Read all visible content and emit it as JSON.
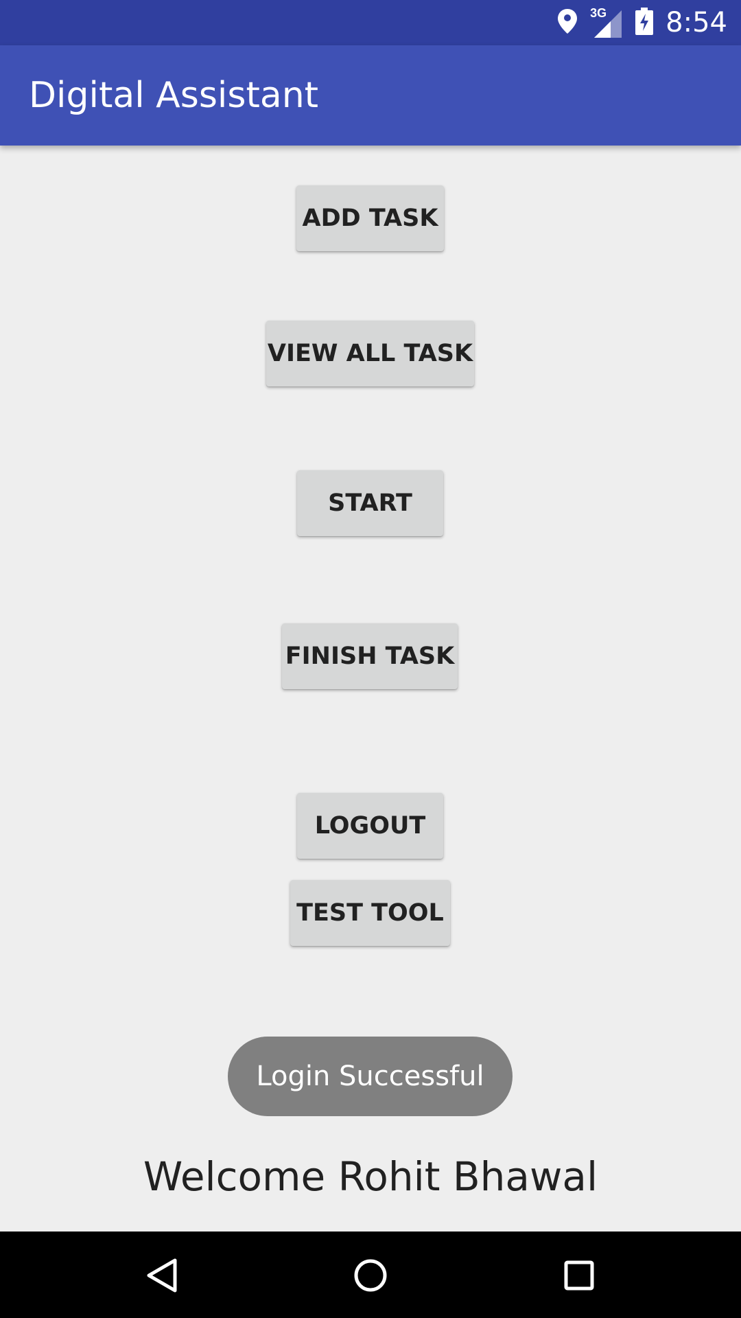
{
  "status_bar": {
    "time": "8:54",
    "network_type": "3G",
    "icons": [
      "location-icon",
      "signal-icon",
      "battery-charging-icon"
    ]
  },
  "app_bar": {
    "title": "Digital Assistant"
  },
  "buttons": {
    "add_task": "ADD TASK",
    "view_all_task": "VIEW ALL TASK",
    "start": "START",
    "finish_task": "FINISH TASK",
    "logout": "LOGOUT",
    "test_tool": "TEST TOOL"
  },
  "toast": {
    "message": "Login Successful"
  },
  "welcome_text": "Welcome Rohit Bhawal",
  "navigation": {
    "icons": [
      "back-icon",
      "home-icon",
      "recent-apps-icon"
    ]
  },
  "colors": {
    "status_bar": "#303f9f",
    "app_bar": "#3f51b5",
    "background": "#eeeeee",
    "button": "#d6d7d7",
    "toast": "#808080",
    "nav_bar": "#000000"
  }
}
